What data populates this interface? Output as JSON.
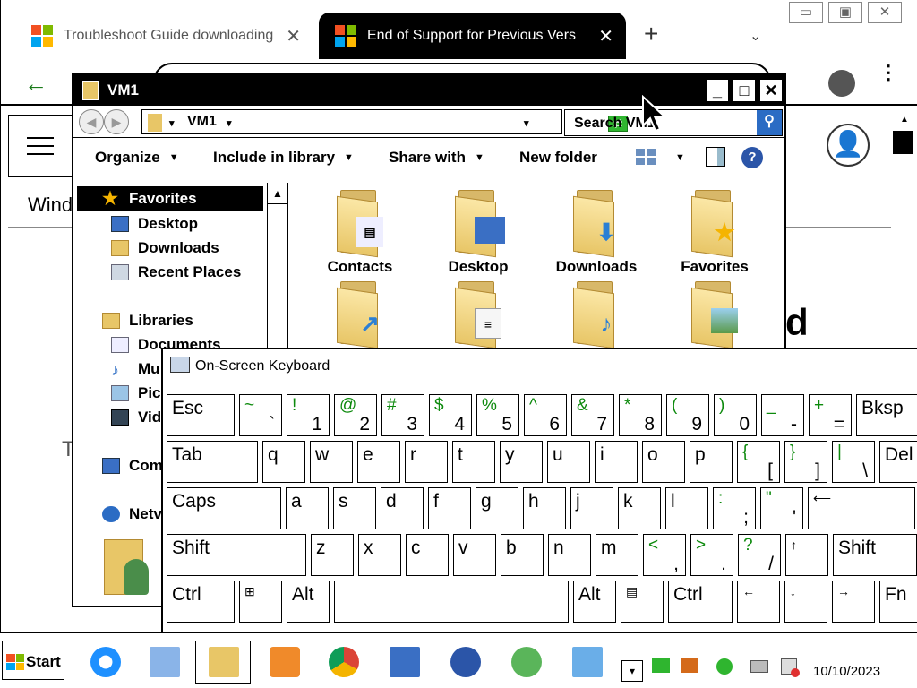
{
  "browser": {
    "tabs": [
      {
        "title": "Troubleshoot Guide downloading",
        "active": false
      },
      {
        "title": "End of Support for Previous Vers",
        "active": true
      }
    ],
    "close_glyph": "✕",
    "new_tab_glyph": "+",
    "tab_menu_glyph": "⌄",
    "back_glyph": "←",
    "window_controls": {
      "minimize": "▭",
      "restore": "▣",
      "close": "✕"
    },
    "site_nav_text": "Wind",
    "page_fragment_left": "T",
    "page_fragment_right": "d",
    "menu_glyph": "⋮",
    "profile_glyph": "👤",
    "scroll_glyph": "▲"
  },
  "explorer": {
    "title": "VM1",
    "address": {
      "path": "VM1",
      "dropdown_glyph": "▾"
    },
    "search_placeholder": "Search VM1",
    "toolbar": {
      "organize": "Organize",
      "include_in_library": "Include in library",
      "share_with": "Share with",
      "new_folder": "New folder",
      "help": "?"
    },
    "nav": {
      "favorites": "Favorites",
      "desktop": "Desktop",
      "downloads": "Downloads",
      "recent_places": "Recent Places",
      "libraries": "Libraries",
      "documents": "Documents",
      "music": "Mu",
      "pictures": "Pic",
      "videos": "Vid",
      "computer": "Com",
      "network": "Netv"
    },
    "files": [
      {
        "label": "Contacts",
        "icon": "contacts-badge"
      },
      {
        "label": "Desktop",
        "icon": "desktop-badge"
      },
      {
        "label": "Downloads",
        "icon": "download-arrow-badge"
      },
      {
        "label": "Favorites",
        "icon": "star-badge"
      },
      {
        "label": "",
        "icon": "shortcut-arrow-badge"
      },
      {
        "label": "",
        "icon": "documents-badge"
      },
      {
        "label": "",
        "icon": "music-note-badge"
      },
      {
        "label": "",
        "icon": "picture-badge"
      }
    ]
  },
  "osk": {
    "title": "On-Screen Keyboard",
    "row1": [
      {
        "p": "Esc"
      },
      {
        "top": "~",
        "bot": "`"
      },
      {
        "top": "!",
        "bot": "1"
      },
      {
        "top": "@",
        "bot": "2"
      },
      {
        "top": "#",
        "bot": "3"
      },
      {
        "top": "$",
        "bot": "4"
      },
      {
        "top": "%",
        "bot": "5"
      },
      {
        "top": "^",
        "bot": "6"
      },
      {
        "top": "&",
        "bot": "7"
      },
      {
        "top": "*",
        "bot": "8"
      },
      {
        "top": "(",
        "bot": "9"
      },
      {
        "top": ")",
        "bot": "0"
      },
      {
        "top": "_",
        "bot": "-"
      },
      {
        "top": "+",
        "bot": "="
      },
      {
        "p": "Bksp"
      }
    ],
    "row2": [
      {
        "p": "Tab"
      },
      {
        "p": "q"
      },
      {
        "p": "w"
      },
      {
        "p": "e"
      },
      {
        "p": "r"
      },
      {
        "p": "t"
      },
      {
        "p": "y"
      },
      {
        "p": "u"
      },
      {
        "p": "i"
      },
      {
        "p": "o"
      },
      {
        "p": "p"
      },
      {
        "top": "{",
        "bot": "["
      },
      {
        "top": "}",
        "bot": "]"
      },
      {
        "top": "|",
        "bot": "\\"
      },
      {
        "p": "Del"
      }
    ],
    "row3": [
      {
        "p": "Caps"
      },
      {
        "p": "a"
      },
      {
        "p": "s"
      },
      {
        "p": "d"
      },
      {
        "p": "f"
      },
      {
        "p": "g"
      },
      {
        "p": "h"
      },
      {
        "p": "j"
      },
      {
        "p": "k"
      },
      {
        "p": "l"
      },
      {
        "top": ":",
        "bot": ";"
      },
      {
        "top": "\"",
        "bot": "'"
      },
      {
        "p": "⟵"
      }
    ],
    "row4": [
      {
        "p": "Shift"
      },
      {
        "p": "z"
      },
      {
        "p": "x"
      },
      {
        "p": "c"
      },
      {
        "p": "v"
      },
      {
        "p": "b"
      },
      {
        "p": "n"
      },
      {
        "p": "m"
      },
      {
        "top": "<",
        "bot": ","
      },
      {
        "top": ">",
        "bot": "."
      },
      {
        "top": "?",
        "bot": "/"
      },
      {
        "p": "↑"
      },
      {
        "p": "Shift"
      }
    ],
    "row5": [
      {
        "p": "Ctrl"
      },
      {
        "p": "⊞"
      },
      {
        "p": "Alt"
      },
      {
        "p": ""
      },
      {
        "p": "Alt"
      },
      {
        "p": "▤"
      },
      {
        "p": "Ctrl"
      },
      {
        "p": "←"
      },
      {
        "p": "↓"
      },
      {
        "p": "→"
      },
      {
        "p": "Fn"
      }
    ]
  },
  "taskbar": {
    "start": "Start",
    "clock": "10/10/2023",
    "tray_popup_glyph": "▾"
  }
}
